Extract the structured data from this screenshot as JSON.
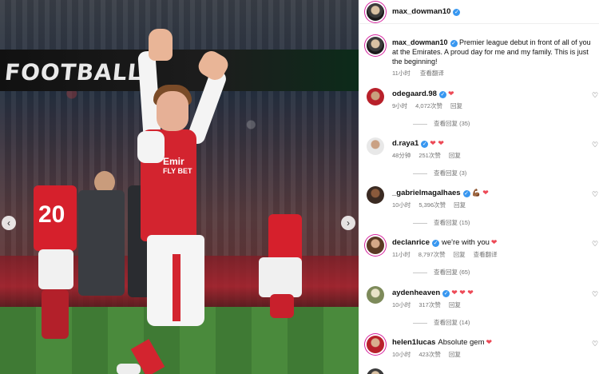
{
  "photo": {
    "banner_text": "FOOTBALL",
    "sponsor_line1": "Emir",
    "sponsor_line2": "FLY BET",
    "jersey_number": "20",
    "prev_icon": "chevron-left-icon",
    "next_icon": "chevron-right-icon",
    "prev_glyph": "‹",
    "next_glyph": "›"
  },
  "header": {
    "username": "max_dowman10",
    "verified": "✓"
  },
  "caption": {
    "username": "max_dowman10",
    "text": "Premier league debut in front of all of you at the Emirates. A proud day for me and my family. This is just the beginning!",
    "time": "11小时",
    "translate": "查看翻译"
  },
  "comments": [
    {
      "username": "odegaard.98",
      "text": "",
      "hearts": "❤",
      "time": "9小时",
      "likes": "4,072次赞",
      "reply": "回复",
      "translate": "",
      "view_replies": "查看回复 (35)"
    },
    {
      "username": "d.raya1",
      "text": "",
      "hearts": "❤ ❤",
      "time": "48分钟",
      "likes": "251次赞",
      "reply": "回复",
      "translate": "",
      "view_replies": "查看回复 (3)"
    },
    {
      "username": "_gabrielmagalhaes",
      "text": "",
      "hearts": "💪🏾 ❤",
      "time": "10小时",
      "likes": "5,396次赞",
      "reply": "回复",
      "translate": "",
      "view_replies": "查看回复 (15)"
    },
    {
      "username": "declanrice",
      "text": "we're with you",
      "hearts": "❤",
      "time": "11小时",
      "likes": "8,797次赞",
      "reply": "回复",
      "translate": "查看翻译",
      "view_replies": "查看回复 (65)"
    },
    {
      "username": "aydenheaven",
      "text": "",
      "hearts": "❤ ❤ ❤",
      "time": "10小时",
      "likes": "317次赞",
      "reply": "回复",
      "translate": "",
      "view_replies": "查看回复 (14)"
    },
    {
      "username": "helen1lucas",
      "text": "Absolute gem",
      "hearts": "❤",
      "time": "10小时",
      "likes": "423次赞",
      "reply": "回复",
      "translate": "",
      "view_replies": ""
    }
  ],
  "like_glyph": "♡",
  "colors": {
    "accent": "#3897f0",
    "heart": "#ed4956",
    "meta": "#737373"
  }
}
